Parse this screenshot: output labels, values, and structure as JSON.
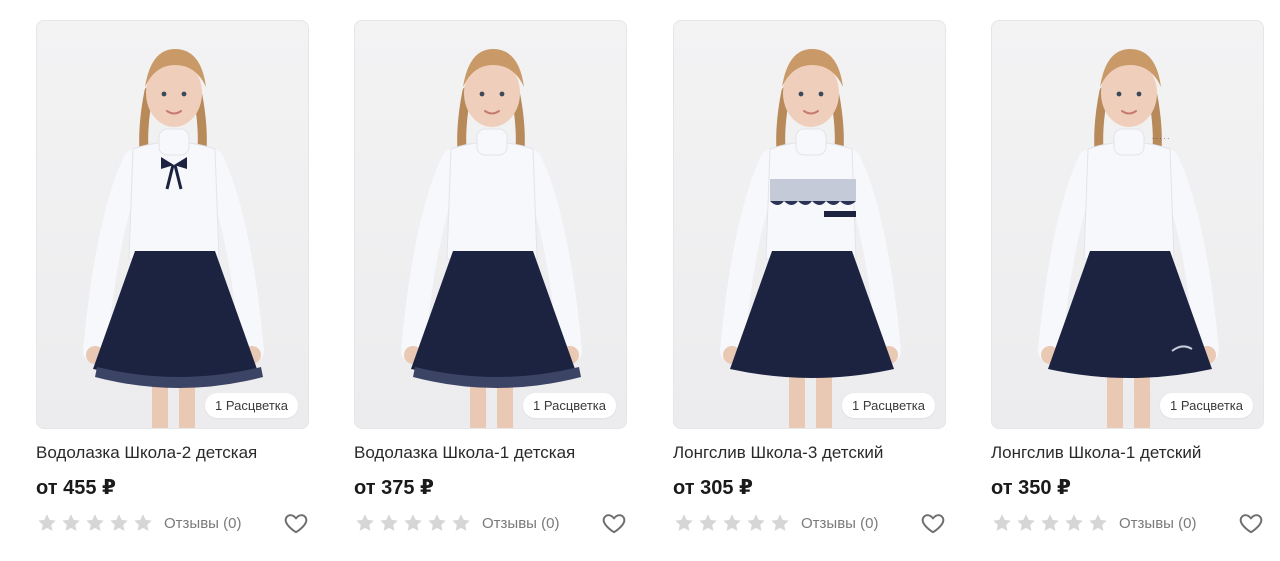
{
  "products": [
    {
      "name": "Водолазка Школа-2 детская",
      "price": "от 455 ₽",
      "badge": "1 Расцветка",
      "reviews": "Отзывы (0)",
      "rating": 0,
      "top_style": "bow"
    },
    {
      "name": "Водолазка Школа-1 детская",
      "price": "от 375 ₽",
      "badge": "1 Расцветка",
      "reviews": "Отзывы (0)",
      "rating": 0,
      "top_style": "plain"
    },
    {
      "name": "Лонгслив Школа-3 детский",
      "price": "от 305 ₽",
      "badge": "1 Расцветка",
      "reviews": "Отзывы (0)",
      "rating": 0,
      "top_style": "lace"
    },
    {
      "name": "Лонгслив Школа-1 детский",
      "price": "от 350 ₽",
      "badge": "1 Расцветка",
      "reviews": "Отзывы (0)",
      "rating": 0,
      "top_style": "print"
    }
  ],
  "icons": {
    "star": "star-icon",
    "favorite": "heart-outline-icon"
  },
  "colors": {
    "star_inactive": "#d6d6d6",
    "skirt": "#1c2340",
    "top": "#f7f8fb",
    "text_muted": "#7a7a7a"
  }
}
